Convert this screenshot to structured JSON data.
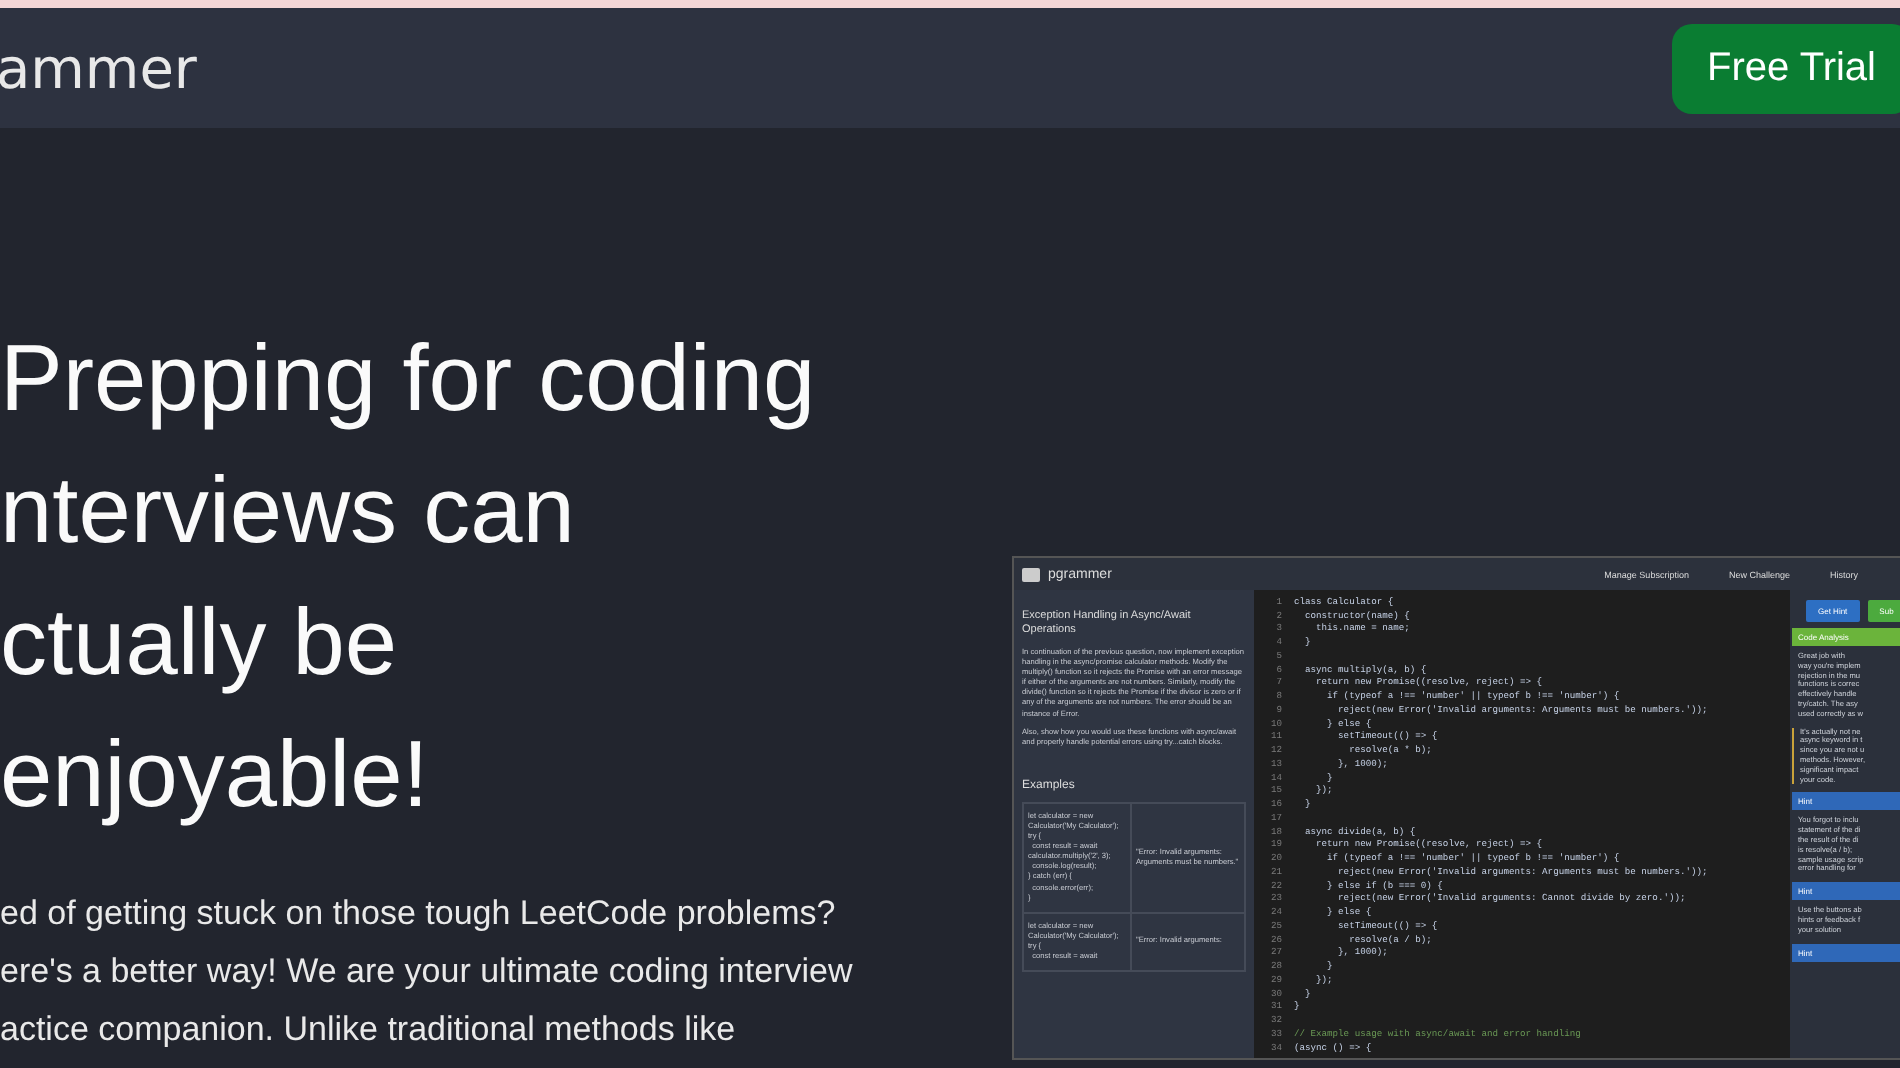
{
  "top_bar": {
    "logo": "ammer",
    "button": "Free Trial"
  },
  "hero": {
    "headline": [
      "Prepping for coding",
      "nterviews can",
      "ctually be",
      "enjoyable!"
    ],
    "body": [
      "ed of getting stuck on those tough LeetCode problems?",
      "ere's a better way! We are your ultimate coding interview",
      "actice companion. Unlike traditional methods like"
    ]
  },
  "app_preview": {
    "logo": "pgrammer",
    "nav": [
      "Manage Subscription",
      "New Challenge",
      "History"
    ],
    "problem": {
      "title": "Exception Handling in Async/Await Operations",
      "paragraphs": [
        "In continuation of the previous question, now implement exception handling in the async/promise calculator methods. Modify the multiply() function so it rejects the Promise with an error message if either of the arguments are not numbers. Similarly, modify the divide() function so it rejects the Promise if the divisor is zero or if any of the arguments are not numbers. The error should be an instance of Error.",
        "Also, show how you would use these functions with async/await and properly handle potential errors using try...catch blocks."
      ],
      "examples_heading": "Examples",
      "examples": [
        {
          "input": "let calculator = new Calculator('My Calculator');\ntry {\n  const result = await calculator.multiply('2', 3);\n  console.log(result);\n} catch (err) {\n  console.error(err);\n}",
          "output": "\"Error: Invalid arguments: Arguments must be numbers.\""
        },
        {
          "input": "let calculator = new Calculator('My Calculator');\ntry {\n  const result = await",
          "output": "\"Error: Invalid arguments:"
        }
      ]
    },
    "code_lines": [
      {
        "n": "1",
        "kind": "code",
        "text": "class Calculator {"
      },
      {
        "n": "2",
        "kind": "code",
        "text": "  constructor(name) {"
      },
      {
        "n": "3",
        "kind": "code",
        "text": "    this.name = name;"
      },
      {
        "n": "4",
        "kind": "code",
        "text": "  }"
      },
      {
        "n": "5"
      },
      {
        "n": "6",
        "kind": "code",
        "text": "  async multiply(a, b) {"
      },
      {
        "n": "7",
        "kind": "code",
        "text": "    return new Promise((resolve, reject) => {"
      },
      {
        "n": "8",
        "kind": "code",
        "text": "      if (typeof a !== 'number' || typeof b !== 'number') {"
      },
      {
        "n": "9",
        "kind": "code",
        "text": "        reject(new Error('Invalid arguments: Arguments must be numbers.'));"
      },
      {
        "n": "10",
        "kind": "code",
        "text": "      } else {"
      },
      {
        "n": "11",
        "kind": "code",
        "text": "        setTimeout(() => {"
      },
      {
        "n": "12",
        "kind": "code",
        "text": "          resolve(a * b);"
      },
      {
        "n": "13",
        "kind": "code",
        "text": "        }, 1000);"
      },
      {
        "n": "14",
        "kind": "code",
        "text": "      }"
      },
      {
        "n": "15",
        "kind": "code",
        "text": "    });"
      },
      {
        "n": "16",
        "kind": "code",
        "text": "  }"
      },
      {
        "n": "17"
      },
      {
        "n": "18",
        "kind": "code",
        "text": "  async divide(a, b) {"
      },
      {
        "n": "19",
        "kind": "code",
        "text": "    return new Promise((resolve, reject) => {"
      },
      {
        "n": "20",
        "kind": "code",
        "text": "      if (typeof a !== 'number' || typeof b !== 'number') {"
      },
      {
        "n": "21",
        "kind": "code",
        "text": "        reject(new Error('Invalid arguments: Arguments must be numbers.'));"
      },
      {
        "n": "22",
        "kind": "code",
        "text": "      } else if (b === 0) {"
      },
      {
        "n": "23",
        "kind": "code",
        "text": "        reject(new Error('Invalid arguments: Cannot divide by zero.'));"
      },
      {
        "n": "24",
        "kind": "code",
        "text": "      } else {"
      },
      {
        "n": "25",
        "kind": "code",
        "text": "        setTimeout(() => {"
      },
      {
        "n": "26",
        "kind": "code",
        "text": "          resolve(a / b);"
      },
      {
        "n": "27",
        "kind": "code",
        "text": "        }, 1000);"
      },
      {
        "n": "28",
        "kind": "code",
        "text": "      }"
      },
      {
        "n": "29",
        "kind": "code",
        "text": "    });"
      },
      {
        "n": "30",
        "kind": "code",
        "text": "  }"
      },
      {
        "n": "31",
        "kind": "code",
        "text": "}"
      },
      {
        "n": "32"
      },
      {
        "n": "33",
        "kind": "comment",
        "text": "// Example usage with async/await and error handling"
      },
      {
        "n": "34",
        "kind": "code",
        "text": "(async () => {"
      }
    ],
    "buttons": [
      {
        "label": "Get Hint",
        "kind": "primary"
      },
      {
        "label": "Sub",
        "kind": "success"
      }
    ],
    "feedback": [
      {
        "kind": "analysis",
        "heading": "Code Analysis",
        "lines": [
          "Great job with",
          "way you're implem",
          "rejection in the mu",
          "functions is correc",
          "effectively handle",
          "try/catch. The asy",
          "used correctly as w"
        ]
      },
      {
        "kind": "text",
        "lines": [
          "It's actually not ne",
          "async keyword in t",
          "since you are not u",
          "methods. However,",
          "significant impact",
          "your code."
        ]
      },
      {
        "kind": "hint",
        "heading": "Hint",
        "lines": [
          "You forgot to inclu",
          "statement of the di",
          "the result of the di",
          "is resolve(a / b);",
          "sample usage scrip",
          "error handling for"
        ]
      },
      {
        "kind": "hint",
        "heading": "Hint",
        "lines": [
          "Use the buttons ab",
          "hints or feedback f",
          "your solution"
        ]
      },
      {
        "kind": "hint",
        "heading": "Hint"
      }
    ]
  }
}
